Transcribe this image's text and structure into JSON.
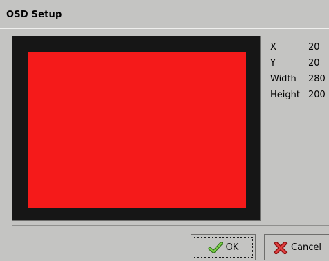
{
  "window": {
    "title": "OSD Setup"
  },
  "osd_info": {
    "rows": [
      {
        "label": "X",
        "value": "20"
      },
      {
        "label": "Y",
        "value": "20"
      },
      {
        "label": "Width",
        "value": "280"
      },
      {
        "label": "Height",
        "value": "200"
      }
    ]
  },
  "buttons": {
    "ok_label": "OK",
    "cancel_label": "Cancel",
    "ok_icon": "green-check-icon",
    "cancel_icon": "red-x-icon"
  },
  "colors": {
    "background": "#c4c4c2",
    "preview_frame": "#161616",
    "osd_area": "#f51a1a"
  }
}
